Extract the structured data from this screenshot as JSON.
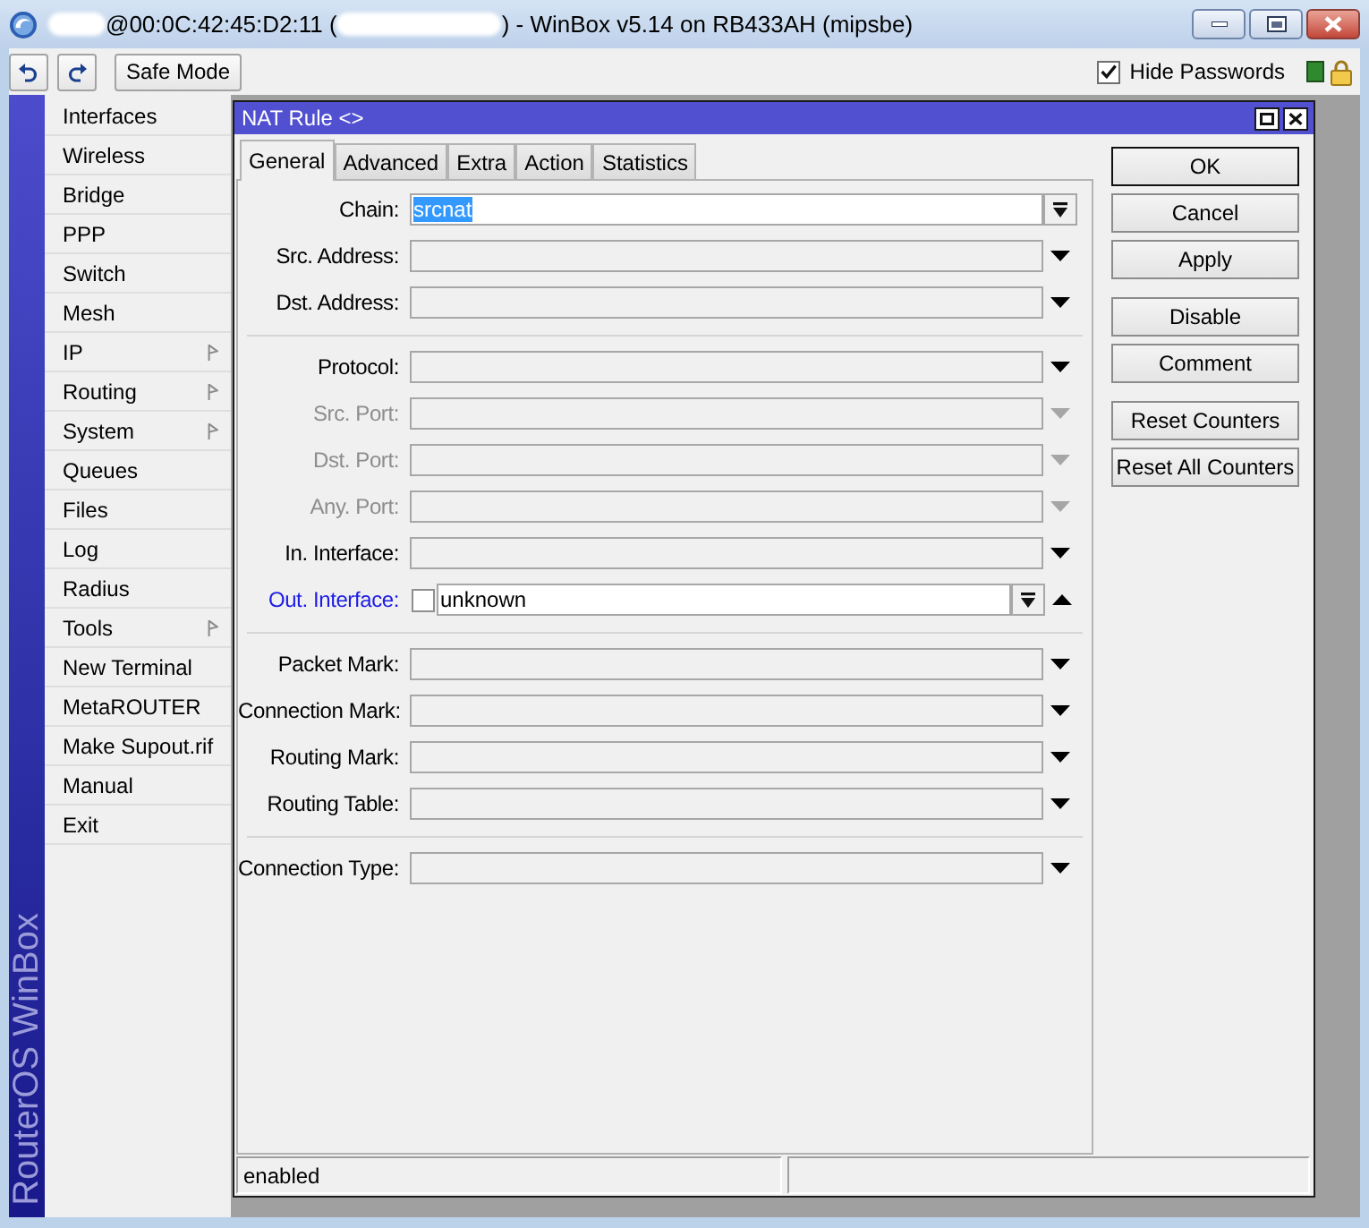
{
  "title_bar": {
    "title_start": "@00:0C:42:45:D2:11 (",
    "title_end": ") - WinBox v5.14 on RB433AH (mipsbe)"
  },
  "toolbar": {
    "safe_mode": {
      "label": "Safe Mode"
    },
    "hide_passwords": {
      "label": "Hide Passwords",
      "checked": true
    }
  },
  "sidebar": {
    "brand": "RouterOS WinBox",
    "items": [
      {
        "label": "Interfaces",
        "submenu": false
      },
      {
        "label": "Wireless",
        "submenu": false
      },
      {
        "label": "Bridge",
        "submenu": false
      },
      {
        "label": "PPP",
        "submenu": false
      },
      {
        "label": "Switch",
        "submenu": false
      },
      {
        "label": "Mesh",
        "submenu": false
      },
      {
        "label": "IP",
        "submenu": true
      },
      {
        "label": "Routing",
        "submenu": true
      },
      {
        "label": "System",
        "submenu": true
      },
      {
        "label": "Queues",
        "submenu": false
      },
      {
        "label": "Files",
        "submenu": false
      },
      {
        "label": "Log",
        "submenu": false
      },
      {
        "label": "Radius",
        "submenu": false
      },
      {
        "label": "Tools",
        "submenu": true
      },
      {
        "label": "New Terminal",
        "submenu": false
      },
      {
        "label": "MetaROUTER",
        "submenu": false
      },
      {
        "label": "Make Supout.rif",
        "submenu": false
      },
      {
        "label": "Manual",
        "submenu": false
      },
      {
        "label": "Exit",
        "submenu": false
      }
    ]
  },
  "nat_rule_window": {
    "title": "NAT Rule <>",
    "tabs": [
      {
        "label": "General",
        "selected": true
      },
      {
        "label": "Advanced",
        "selected": false
      },
      {
        "label": "Extra",
        "selected": false
      },
      {
        "label": "Action",
        "selected": false
      },
      {
        "label": "Statistics",
        "selected": false
      }
    ],
    "rows": [
      {
        "kind": "combo",
        "label": "Chain:",
        "value": "srcnat",
        "text_selected": true,
        "disabled": false,
        "highlighted": false
      },
      {
        "kind": "select",
        "label": "Src. Address:",
        "disabled": false,
        "highlighted": false,
        "expanded": false
      },
      {
        "kind": "select",
        "label": "Dst. Address:",
        "disabled": false,
        "highlighted": false,
        "expanded": false
      },
      {
        "kind": "separator"
      },
      {
        "kind": "select",
        "label": "Protocol:",
        "disabled": false,
        "highlighted": false,
        "expanded": false
      },
      {
        "kind": "select",
        "label": "Src. Port:",
        "disabled": true,
        "highlighted": false,
        "expanded": false
      },
      {
        "kind": "select",
        "label": "Dst. Port:",
        "disabled": true,
        "highlighted": false,
        "expanded": false
      },
      {
        "kind": "select",
        "label": "Any. Port:",
        "disabled": true,
        "highlighted": false,
        "expanded": false
      },
      {
        "kind": "select",
        "label": "In. Interface:",
        "disabled": false,
        "highlighted": false,
        "expanded": false
      },
      {
        "kind": "negatable_combo",
        "label": "Out. Interface:",
        "negated": false,
        "value": "unknown",
        "text_selected": false,
        "disabled": false,
        "highlighted": true,
        "expanded": true
      },
      {
        "kind": "separator"
      },
      {
        "kind": "select",
        "label": "Packet Mark:",
        "disabled": false,
        "highlighted": false,
        "expanded": false
      },
      {
        "kind": "select",
        "label": "Connection Mark:",
        "disabled": false,
        "highlighted": false,
        "expanded": false
      },
      {
        "kind": "select",
        "label": "Routing Mark:",
        "disabled": false,
        "highlighted": false,
        "expanded": false
      },
      {
        "kind": "select",
        "label": "Routing Table:",
        "disabled": false,
        "highlighted": false,
        "expanded": false
      },
      {
        "kind": "separator"
      },
      {
        "kind": "select",
        "label": "Connection Type:",
        "disabled": false,
        "highlighted": false,
        "expanded": false
      }
    ],
    "button_groups": [
      {
        "buttons": [
          {
            "label": "OK",
            "default": true
          },
          {
            "label": "Cancel",
            "default": false
          },
          {
            "label": "Apply",
            "default": false
          }
        ]
      },
      {
        "buttons": [
          {
            "label": "Disable",
            "default": false
          },
          {
            "label": "Comment",
            "default": false
          }
        ]
      },
      {
        "buttons": [
          {
            "label": "Reset Counters",
            "default": false
          },
          {
            "label": "Reset All Counters",
            "default": false
          }
        ]
      }
    ],
    "status_bar": {
      "text": "enabled"
    }
  }
}
